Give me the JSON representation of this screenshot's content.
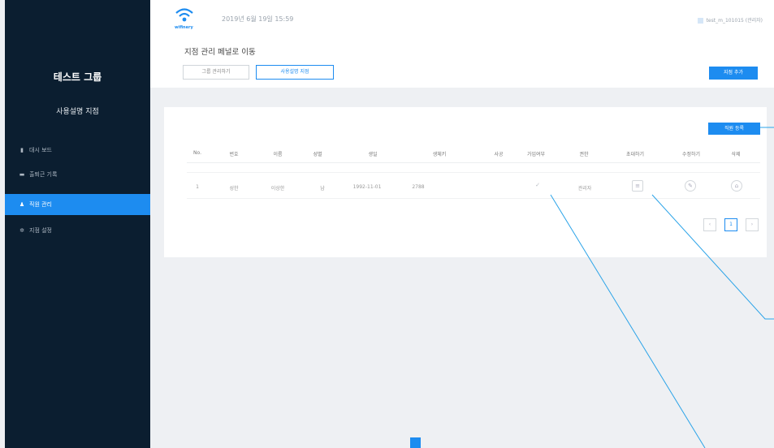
{
  "sidebar": {
    "group_title": "테스트 그룹",
    "subtitle": "사용설명 지점",
    "items": [
      {
        "icon": "chart-icon",
        "glyph": "▮",
        "label": "대시 보드",
        "active": false
      },
      {
        "icon": "card-icon",
        "glyph": "▬",
        "label": "출퇴근 기록",
        "active": false
      },
      {
        "icon": "people-icon",
        "glyph": "♟",
        "label": "직원 관리",
        "active": true
      },
      {
        "icon": "gear-icon",
        "glyph": "✲",
        "label": "지점 설정",
        "active": false
      }
    ]
  },
  "header": {
    "logo_text": "wifinery",
    "datetime": "2019년 6월 19일 15:59",
    "user": "test_m_101015 (관리자)"
  },
  "subbar": {
    "title": "지점 관리 페널로 이동",
    "group_button": "그룹 관리하기",
    "branch_button": "사용설명 지점",
    "add_branch_button": "지점 추가"
  },
  "table": {
    "register_button": "직원 등록",
    "headers": [
      "No.",
      "번호",
      "이름",
      "성별",
      "생일",
      "생체키",
      "사공",
      "가입여부",
      "권한",
      "초대하기",
      "수정하기",
      "삭제"
    ],
    "rows": [
      {
        "no": "1",
        "num": "성한",
        "name": "이상한",
        "gender": "남",
        "birthday": "1992-11-01",
        "key": "2788",
        "role": "관리자",
        "joined_icon": "check-icon",
        "invite_icon": "mail-icon",
        "edit_icon": "pencil-icon",
        "delete_icon": "trash-icon"
      }
    ]
  },
  "pagination": {
    "prev": "‹",
    "current": "1",
    "next": "›"
  },
  "colors": {
    "accent": "#1d8cf0",
    "sidebar": "#0b1e30",
    "annotation": "#2aa3e8"
  }
}
